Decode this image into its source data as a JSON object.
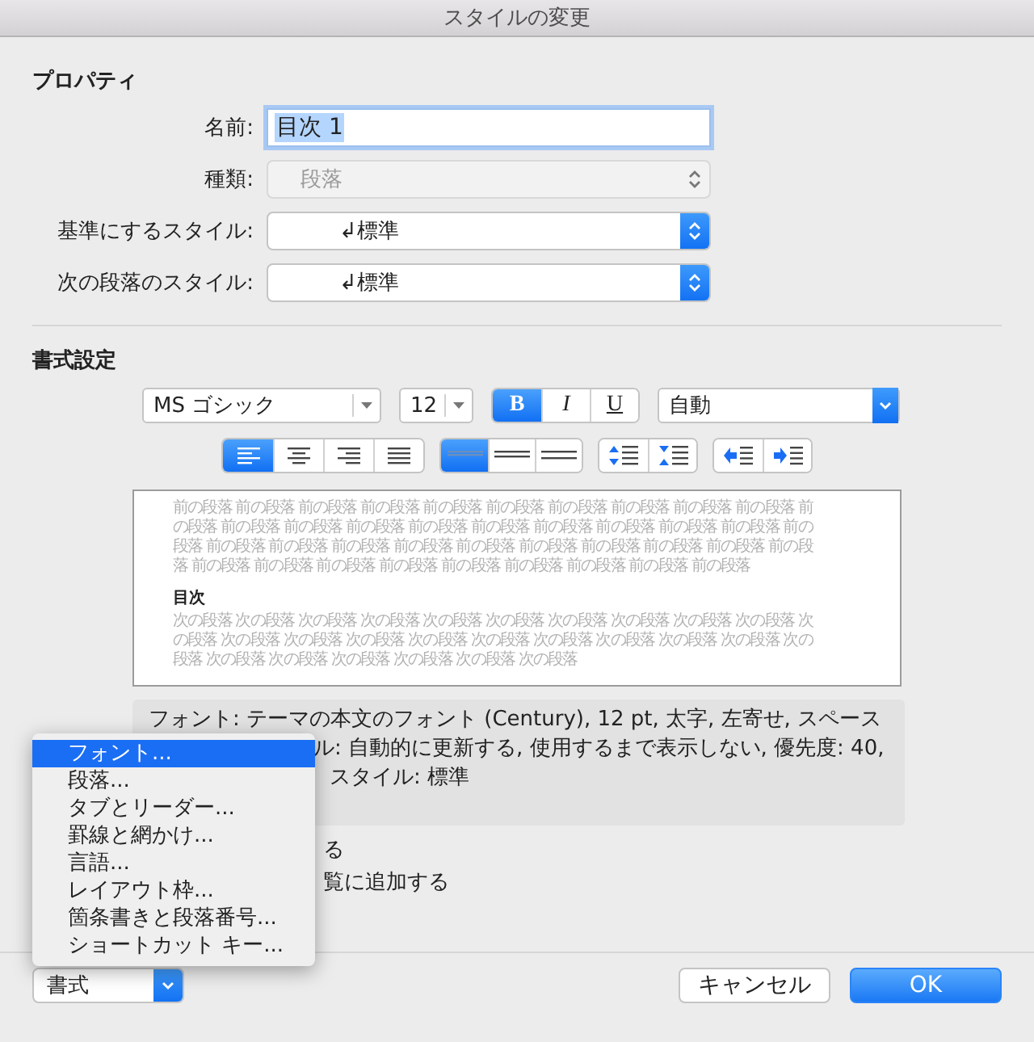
{
  "window": {
    "title": "スタイルの変更"
  },
  "properties": {
    "heading": "プロパティ",
    "fields": [
      {
        "kind": "text",
        "label": "名前:",
        "value": "目次 1",
        "disabled": false
      },
      {
        "kind": "select",
        "label": "種類:",
        "value": "段落",
        "disabled": true
      },
      {
        "kind": "select",
        "label": "基準にするスタイル:",
        "value": "↲標準",
        "disabled": false
      },
      {
        "kind": "select",
        "label": "次の段落のスタイル:",
        "value": "↲標準",
        "disabled": false
      }
    ]
  },
  "formatting": {
    "heading": "書式設定",
    "font": "MS ゴシック",
    "size": "12",
    "styles": [
      {
        "label": "B",
        "selected": true
      },
      {
        "label": "I",
        "selected": false
      },
      {
        "label": "U",
        "selected": false
      }
    ],
    "ink": "自動",
    "alignment": [
      {
        "selected": true
      },
      {
        "selected": false
      },
      {
        "selected": false
      },
      {
        "selected": false
      }
    ],
    "line_spacing": [
      {
        "selected": true
      },
      {
        "selected": false
      },
      {
        "selected": false
      }
    ]
  },
  "preview": {
    "before": [
      "前の段落 前の段落 前の段落 前の段落 前の段落 前の段落 前の段落 前の段落 前の段落 前の段落 前",
      "の段落 前の段落 前の段落 前の段落 前の段落 前の段落 前の段落 前の段落 前の段落 前の段落 前の",
      "段落 前の段落 前の段落 前の段落 前の段落 前の段落 前の段落 前の段落 前の段落 前の段落 前の段",
      "落 前の段落 前の段落 前の段落 前の段落 前の段落 前の段落 前の段落 前の段落 前の段落"
    ],
    "sample": "目次",
    "after": [
      "次の段落 次の段落 次の段落 次の段落 次の段落 次の段落 次の段落 次の段落 次の段落 次の段落 次",
      "の段落 次の段落 次の段落 次の段落 次の段落 次の段落 次の段落 次の段落 次の段落 次の段落 次の",
      "段落 次の段落 次の段落 次の段落 次の段落 次の段落 次の段落"
    ]
  },
  "description": [
    "フォント: テーマの本文のフォント (Century), 12 pt, 太字, 左寄せ, スペース",
    "ル: 自動的に更新する, 使用するまで表示しない, 優先度: 40,",
    "スタイル: 標準"
  ],
  "options": [
    "る",
    "覧に追加する"
  ],
  "format_menu": {
    "button": "書式",
    "items": [
      {
        "label": "フォント...",
        "selected": true
      },
      {
        "label": "段落...",
        "selected": false
      },
      {
        "label": "タブとリーダー...",
        "selected": false
      },
      {
        "label": "罫線と網かけ...",
        "selected": false
      },
      {
        "label": "言語...",
        "selected": false
      },
      {
        "label": "レイアウト枠...",
        "selected": false
      },
      {
        "label": "箇条書きと段落番号...",
        "selected": false
      },
      {
        "label": "ショートカット キー...",
        "selected": false
      }
    ]
  },
  "buttons": [
    {
      "kind": "cancel",
      "label": "キャンセル"
    },
    {
      "kind": "default",
      "label": "OK"
    }
  ]
}
